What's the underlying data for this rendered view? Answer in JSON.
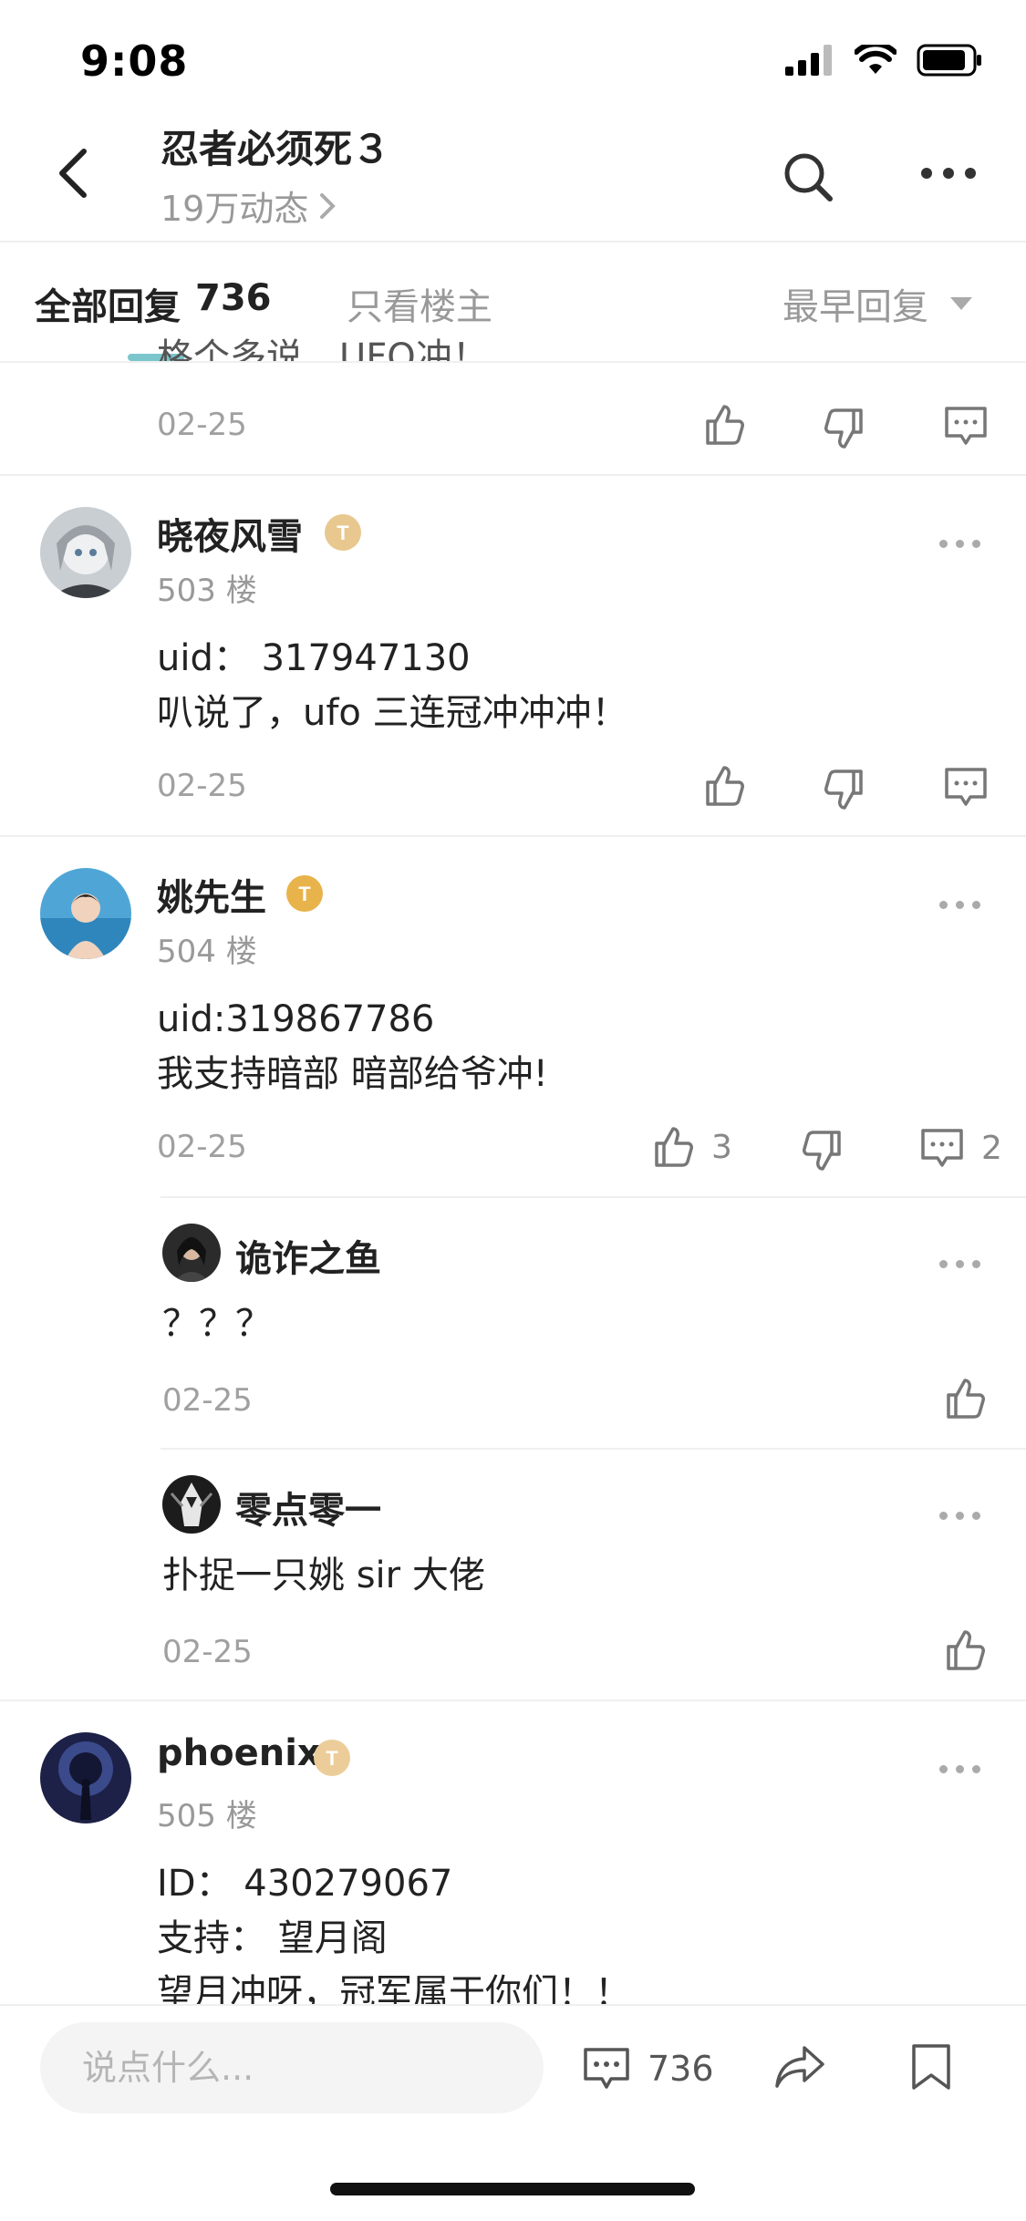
{
  "status_bar": {
    "time": "9:08"
  },
  "header": {
    "title": "忍者必须死３",
    "subtitle": "19万动态"
  },
  "tabs": {
    "all_label": "全部回复",
    "all_count": "736",
    "op_only": "只看楼主",
    "sort": "最早回复"
  },
  "prev_post": {
    "text_partial": "格个多说，UFO冲！",
    "date": "02-25"
  },
  "posts": [
    {
      "name": "晓夜风雪",
      "badge": "T5",
      "floor": "503 楼",
      "lines": [
        "uid： 317947130",
        "叭说了，ufo 三连冠冲冲冲！"
      ],
      "date": "02-25"
    },
    {
      "name": "姚先生",
      "badge": "T7",
      "floor": "504 楼",
      "lines": [
        "uid:319867786",
        "我支持暗部 暗部给爷冲!"
      ],
      "date": "02-25",
      "likes": "3",
      "comments": "2",
      "replies": [
        {
          "name": "诡诈之鱼",
          "text": "？？？",
          "date": "02-25"
        },
        {
          "name": "零点零一",
          "text": "扑捉一只姚 sir 大佬",
          "date": "02-25"
        }
      ]
    },
    {
      "name": "phoenix",
      "badge": "T4",
      "floor": "505 楼",
      "lines": [
        "ID： 430279067",
        "支持： 望月阁",
        "望月冲呀，冠军属于你们！！"
      ]
    }
  ],
  "bottom_bar": {
    "placeholder": "说点什么...",
    "comment_count": "736"
  },
  "colors": {
    "accent": "#7bc6cc",
    "badge_gold": "#e8b34b",
    "text": "#222222",
    "muted": "#999999"
  },
  "icons": [
    "back-arrow-icon",
    "search-icon",
    "more-icon",
    "thumb-up-icon",
    "thumb-down-icon",
    "comment-icon",
    "share-icon",
    "bookmark-icon",
    "chevron-right-icon",
    "caret-down-icon"
  ]
}
